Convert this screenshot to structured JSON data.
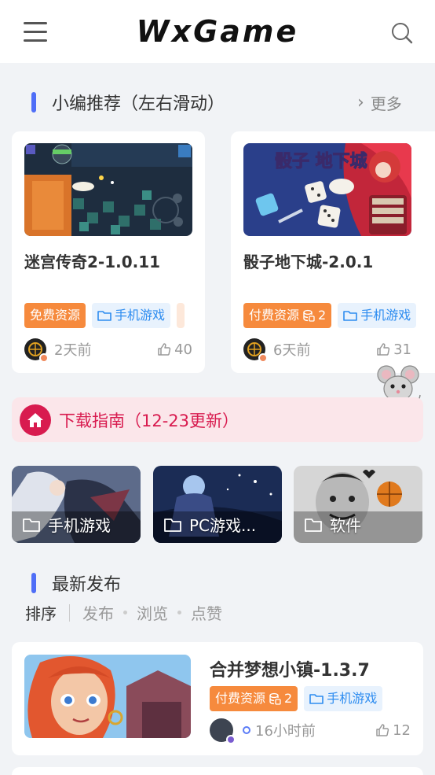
{
  "header": {
    "logo": "WxGame"
  },
  "featured": {
    "title": "小编推荐（左右滑动）",
    "more": "更多",
    "items": [
      {
        "title": "迷宫传奇2-1.0.11",
        "tags": [
          {
            "label": "免费资源",
            "style": "orange"
          },
          {
            "label": "手机游戏",
            "style": "blue"
          }
        ],
        "time": "2天前",
        "likes": "40"
      },
      {
        "title": "骰子地下城-2.0.1",
        "tags": [
          {
            "label": "付费资源",
            "count": "2",
            "style": "orange"
          },
          {
            "label": "手机游戏",
            "style": "blue"
          }
        ],
        "time": "6天前",
        "likes": "31",
        "thumb_title": "骰子 地下城"
      }
    ]
  },
  "guide": {
    "text": "下载指南（12-23更新）"
  },
  "categories": [
    {
      "label": "手机游戏"
    },
    {
      "label": "PC游戏..."
    },
    {
      "label": "软件"
    }
  ],
  "latest": {
    "title": "最新发布",
    "sort": {
      "label": "排序",
      "options": [
        "发布",
        "浏览",
        "点赞"
      ]
    },
    "posts": [
      {
        "title": "合并梦想小镇-1.3.7",
        "tags": [
          {
            "label": "付费资源",
            "count": "2",
            "style": "orange"
          },
          {
            "label": "手机游戏",
            "style": "blue"
          }
        ],
        "time": "16小时前",
        "likes": "12"
      }
    ]
  },
  "colors": {
    "accent": "#4f6ef7",
    "orange_tag": "#f68a3d",
    "blue_tag": "#2d8cf0",
    "guide": "#d81b4f"
  },
  "icons": [
    "menu-icon",
    "search-icon",
    "chevron-right-icon",
    "folder-icon",
    "thumbs-up-icon",
    "home-icon",
    "coins-icon",
    "mouse-mascot-icon"
  ]
}
